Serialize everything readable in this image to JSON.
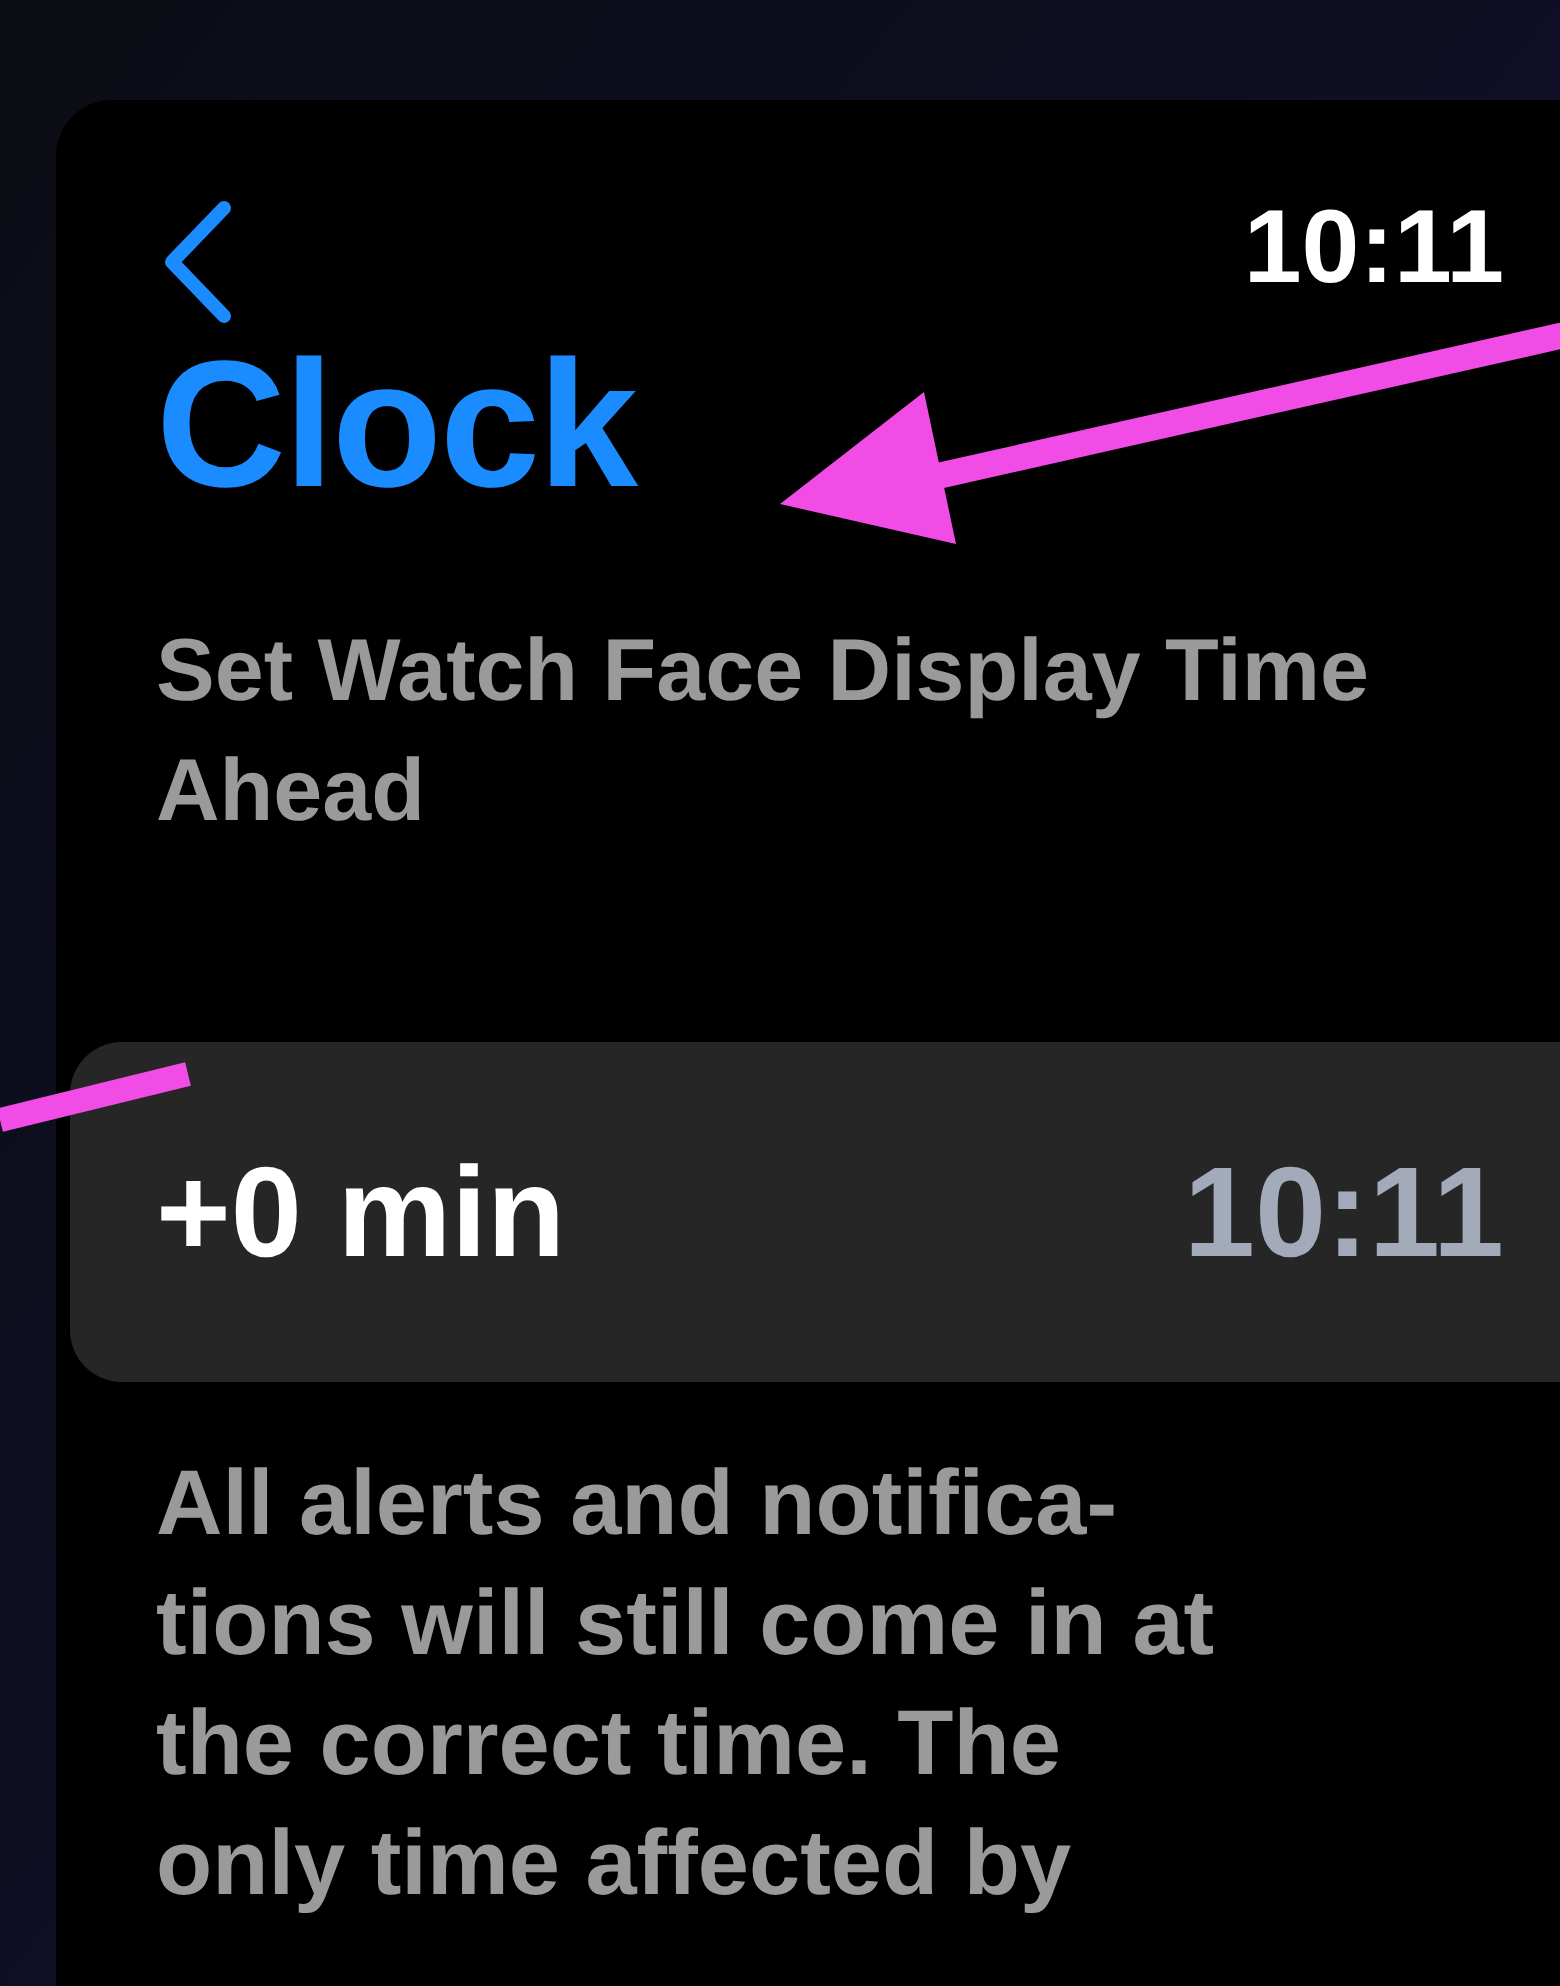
{
  "status_bar": {
    "time": "10:11"
  },
  "header": {
    "title": "Clock"
  },
  "subtitle": "Set Watch Face Display Time Ahead",
  "offset_row": {
    "offset": "+0 min",
    "time": "10:11"
  },
  "description_lines": [
    "All alerts and notifica-",
    "tions will still come in at",
    "the correct time. The",
    "only time affected by"
  ]
}
